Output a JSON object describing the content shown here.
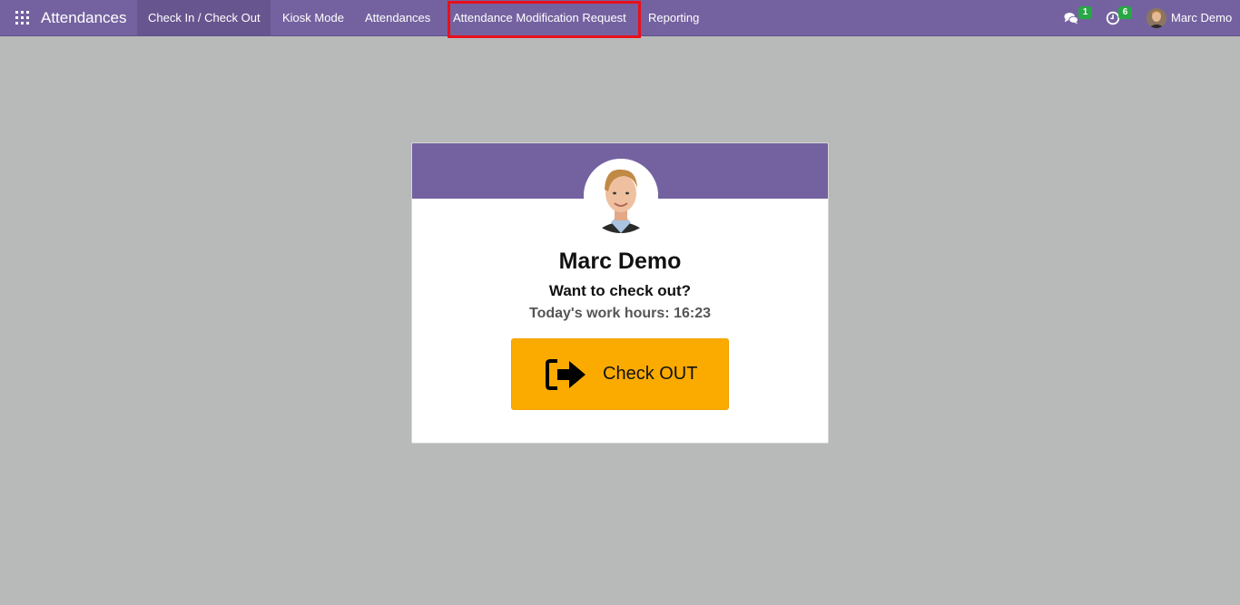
{
  "navbar": {
    "brand": "Attendances",
    "menu": [
      {
        "label": "Check In / Check Out",
        "active": true
      },
      {
        "label": "Kiosk Mode",
        "active": false
      },
      {
        "label": "Attendances",
        "active": false
      },
      {
        "label": "Attendance Modification Request",
        "active": false,
        "highlighted": true
      },
      {
        "label": "Reporting",
        "active": false
      }
    ],
    "messages_badge": "1",
    "activities_badge": "6",
    "user_name": "Marc Demo"
  },
  "card": {
    "employee_name": "Marc Demo",
    "question": "Want to check out?",
    "work_hours": "Today's work hours: 16:23",
    "button_label": "Check OUT"
  },
  "colors": {
    "brand": "#7462a0",
    "background": "#b8bab9",
    "checkout_button": "#fbab00",
    "badge": "#28a745",
    "highlight_box": "#e8101c"
  },
  "icons": [
    "apps-grid-icon",
    "chat-bubbles-icon",
    "clock-icon",
    "sign-out-icon"
  ]
}
